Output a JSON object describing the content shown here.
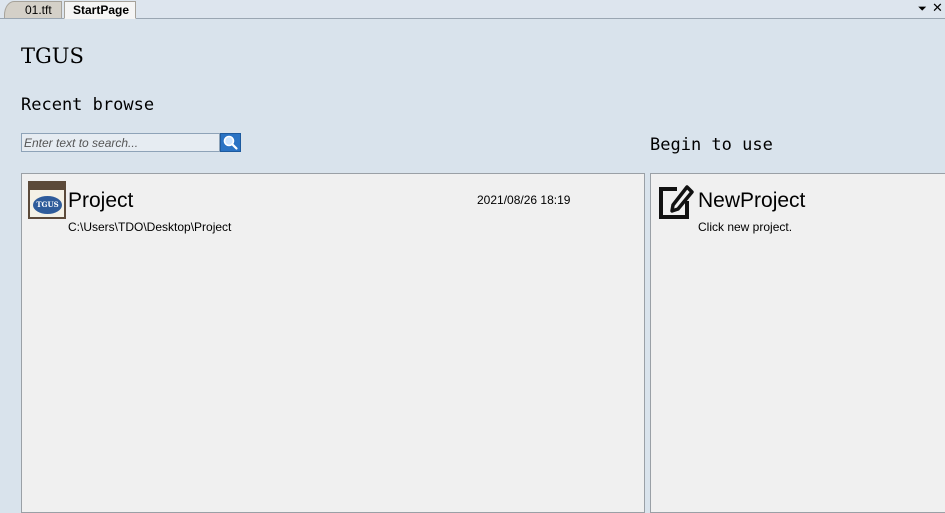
{
  "tabs": [
    {
      "label": "01.tft",
      "active": false
    },
    {
      "label": "StartPage",
      "active": true
    }
  ],
  "tab_controls": {
    "menu_glyph": "⏷",
    "close_glyph": "✕"
  },
  "brand": "TGUS",
  "recent": {
    "title": "Recent browse",
    "search_placeholder": "Enter text to search...",
    "items": [
      {
        "name": "Project",
        "date": "2021/08/26 18:19",
        "path": "C:\\Users\\TDO\\Desktop\\Project",
        "icon_text": "TGUS"
      }
    ]
  },
  "begin": {
    "title": "Begin to use",
    "items": [
      {
        "name": "NewProject",
        "description": "Click new project.",
        "icon": "edit-icon"
      }
    ]
  },
  "colors": {
    "accent": "#2a73c4",
    "background": "#d9e3ec",
    "panel": "#f0f0f0"
  }
}
